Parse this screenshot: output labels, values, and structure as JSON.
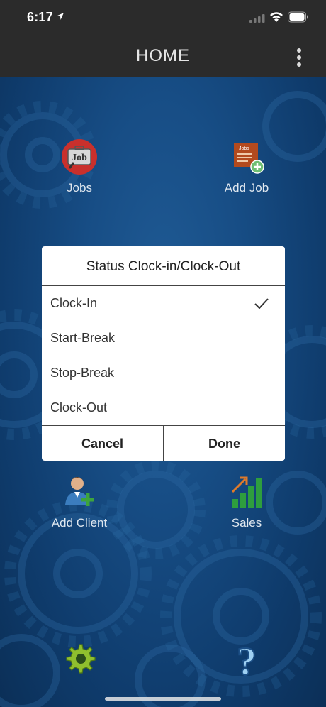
{
  "status_bar": {
    "time": "6:17"
  },
  "header": {
    "title": "HOME"
  },
  "tiles": [
    {
      "label": "Jobs",
      "icon": "jobs-icon"
    },
    {
      "label": "Add Job",
      "icon": "add-job-icon"
    },
    {
      "label": "Add Client",
      "icon": "add-client-icon"
    },
    {
      "label": "Sales",
      "icon": "sales-chart-icon"
    },
    {
      "label": "",
      "icon": "gear-icon"
    },
    {
      "label": "",
      "icon": "help-icon"
    }
  ],
  "dialog": {
    "title": "Status Clock-in/Clock-Out",
    "options": [
      {
        "label": "Clock-In",
        "selected": true
      },
      {
        "label": "Start-Break",
        "selected": false
      },
      {
        "label": "Stop-Break",
        "selected": false
      },
      {
        "label": "Clock-Out",
        "selected": false
      }
    ],
    "cancel_label": "Cancel",
    "done_label": "Done"
  },
  "colors": {
    "header_bg": "#2b2b2b",
    "background_blue": "#174d85",
    "dialog_bg": "#ffffff",
    "sales_green": "#2e9e3e"
  }
}
